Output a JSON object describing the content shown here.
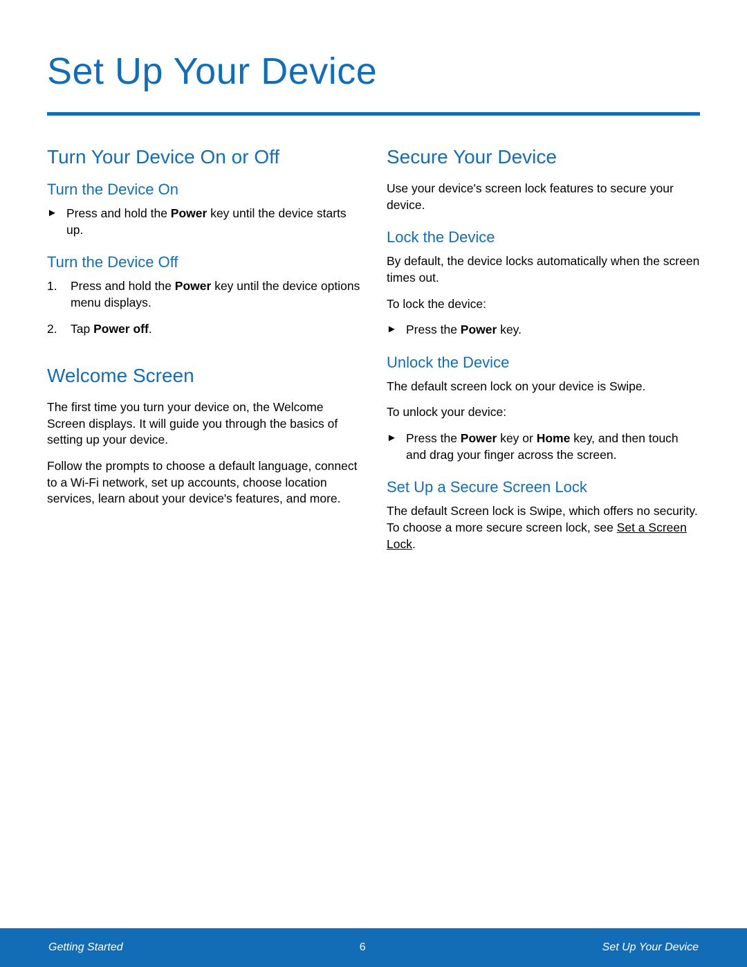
{
  "title": "Set Up Your Device",
  "left": {
    "h2a": "Turn Your Device On or Off",
    "sub_on": "Turn the Device On",
    "on_bullet_pre": "Press and hold the ",
    "on_bullet_bold": "Power",
    "on_bullet_post": " key until the device starts up.",
    "sub_off": "Turn the Device Off",
    "off1_pre": "Press and hold the ",
    "off1_bold": "Power",
    "off1_post": " key until the  device options menu displays.",
    "off2_pre": "Tap ",
    "off2_bold": "Power off",
    "off2_post": ".",
    "h2b": "Welcome Screen",
    "welcome_p1": "The first time you turn your device on, the Welcome Screen displays. It will guide you through the basics of setting up your device.",
    "welcome_p2": "Follow the prompts to choose a default language, connect to a Wi-Fi network, set up accounts, choose location services, learn about your device's features, and more."
  },
  "right": {
    "h2a": "Secure Your Device",
    "intro": "Use your device's screen lock features to secure your device.",
    "sub_lock": "Lock the Device",
    "lock_p1": "By default, the device locks automatically when the screen times out.",
    "lock_p2": "To lock the device:",
    "lock_bullet_pre": "Press the ",
    "lock_bullet_bold": "Power",
    "lock_bullet_post": " key.",
    "sub_unlock": "Unlock the Device",
    "unlock_p1": "The default screen lock on your device is Swipe.",
    "unlock_p2": "To unlock your device:",
    "unlock_bullet_pre": "Press the ",
    "unlock_bullet_b1": "Power",
    "unlock_bullet_mid": " key or ",
    "unlock_bullet_b2": "Home",
    "unlock_bullet_post": " key, and then touch and drag your finger across the screen.",
    "sub_secure": "Set Up a Secure Screen Lock",
    "secure_p_pre": "The default Screen lock is Swipe, which offers no security. To choose a more secure screen lock, see ",
    "secure_link": "Set a Screen Lock",
    "secure_p_post": "."
  },
  "footer": {
    "left": "Getting Started",
    "center": "6",
    "right": "Set Up Your Device"
  },
  "arrow": "►"
}
